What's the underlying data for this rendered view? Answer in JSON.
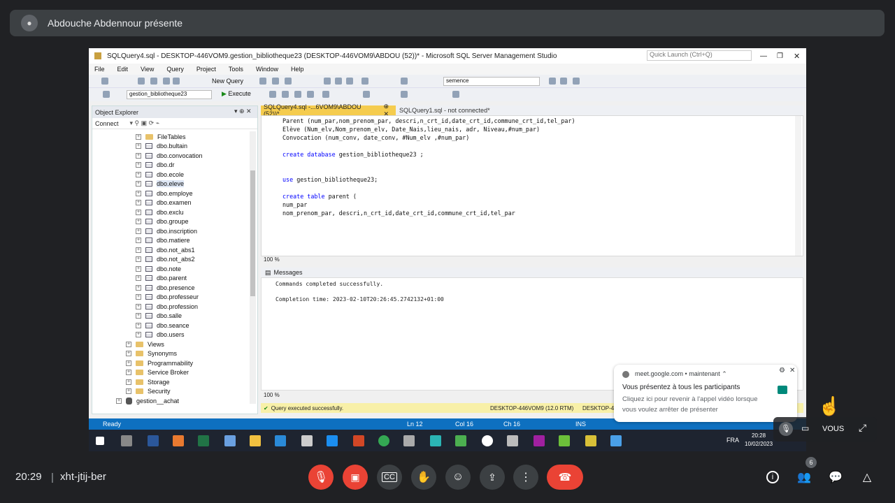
{
  "presenter": {
    "name": "Abdouche Abdennour présente"
  },
  "ssms": {
    "title": "SQLQuery4.sql - DESKTOP-446VOM9.gestion_bibliotheque23 (DESKTOP-446VOM9\\ABDOU (52))* - Microsoft SQL Server Management Studio",
    "quick_launch": "Quick Launch (Ctrl+Q)",
    "menu": [
      "File",
      "Edit",
      "View",
      "Query",
      "Project",
      "Tools",
      "Window",
      "Help"
    ],
    "toolbar": {
      "new_query": "New Query",
      "database_combo": "semence",
      "current_db": "gestion_bibliotheque23",
      "execute": "Execute"
    },
    "object_explorer": {
      "title": "Object Explorer",
      "connect": "Connect",
      "file_tables": "FileTables",
      "tables": [
        "dbo.bultain",
        "dbo.convocation",
        "dbo.dr",
        "dbo.ecole",
        "dbo.eleve",
        "dbo.employe",
        "dbo.examen",
        "dbo.exclu",
        "dbo.groupe",
        "dbo.inscription",
        "dbo.matiere",
        "dbo.not_abs1",
        "dbo.not_abs2",
        "dbo.note",
        "dbo.parent",
        "dbo.presence",
        "dbo.professeur",
        "dbo.profession",
        "dbo.salle",
        "dbo.seance",
        "dbo.users"
      ],
      "folders": [
        "Views",
        "Synonyms",
        "Programmability",
        "Service Broker",
        "Storage",
        "Security"
      ],
      "next_db": "gestion__achat"
    },
    "tabs": {
      "active": "SQLQuery4.sql -...6VOM9\\ABDOU (52))*",
      "other": "SQLQuery1.sql - not connected*"
    },
    "code": {
      "l1": "Parent (num_par,nom_prenom_par, descri,n_crt_id,date_crt_id,commune_crt_id,tel_par)",
      "l2": "Elève (Num_elv,Nom_prenom_elv, Date_Nais,lieu_nais, adr, Niveau,#num_par)",
      "l3": "Convocation (num_conv, date_conv, #Num_elv ,#num_par)",
      "l4_kw": "create database",
      "l4": "gestion_bibliotheque23 ;",
      "l5_kw": "use",
      "l5": "gestion_bibliotheque23;",
      "l6_kw": "create table",
      "l6": "parent (",
      "l7": "num_par",
      "l8": "nom_prenom_par, descri,n_crt_id,date_crt_id,commune_crt_id,tel_par"
    },
    "editor_zoom": "100 %",
    "messages_tab": "Messages",
    "messages": [
      "Commands completed successfully.",
      "Completion time: 2023-02-10T20:26:45.2742132+01:00"
    ],
    "results_zoom": "100 %",
    "query_status": "Query executed successfully.",
    "server_status": "DESKTOP-446VOM9 (12.0 RTM)",
    "server_status_2": "DESKTOP-4",
    "status": {
      "ready": "Ready",
      "ln": "Ln 12",
      "col": "Col 16",
      "ch": "Ch 16",
      "ins": "INS"
    },
    "taskbar": {
      "lang": "FRA",
      "time": "20:28",
      "date": "10/02/2023"
    }
  },
  "notification": {
    "source": "meet.google.com",
    "when": "maintenant",
    "title": "Vous présentez à tous les participants",
    "body": "Cliquez ici pour revenir à l'appel vidéo lorsque vous voulez arrêter de présenter"
  },
  "self_tile": {
    "label": "Vous"
  },
  "meeting": {
    "time": "20:29",
    "code": "xht-jtij-ber",
    "participants": "6"
  },
  "colors": {
    "end_call": "#ea4335",
    "ssms_status": "#0e70c0",
    "tab_active": "#f5cc4e"
  }
}
